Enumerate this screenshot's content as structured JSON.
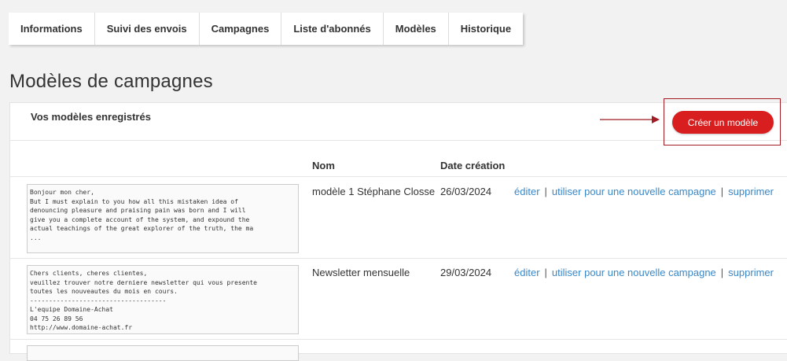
{
  "tabs": [
    "Informations",
    "Suivi des envois",
    "Campagnes",
    "Liste d'abonnés",
    "Modèles",
    "Historique"
  ],
  "page_title": "Modèles de campagnes",
  "panel": {
    "title": "Vos modèles enregistrés",
    "create_button": "Créer un modèle"
  },
  "columns": {
    "name": "Nom",
    "date": "Date création"
  },
  "actions": {
    "edit": "éditer",
    "use": "utiliser pour une nouvelle campagne",
    "delete": "supprimer",
    "separator": "|"
  },
  "templates": [
    {
      "preview": "Bonjour mon cher,\nBut I must explain to you how all this mistaken idea of\ndenouncing pleasure and praising pain was born and I will\ngive you a complete account of the system, and expound the\nactual teachings of the great explorer of the truth, the ma\n...",
      "name": "modèle 1 Stéphane Closse",
      "date": "26/03/2024"
    },
    {
      "preview": "Chers clients, cheres clientes,\nveuillez trouver notre derniere newsletter qui vous presente\ntoutes les nouveautes du mois en cours.\n------------------------------------\nL'equipe Domaine-Achat\n04 75 26 89 56\nhttp://www.domaine-achat.fr",
      "name": "Newsletter mensuelle",
      "date": "29/03/2024"
    }
  ],
  "colors": {
    "accent": "#d81e1e",
    "link": "#3a87c8",
    "highlight": "#a11c24"
  }
}
